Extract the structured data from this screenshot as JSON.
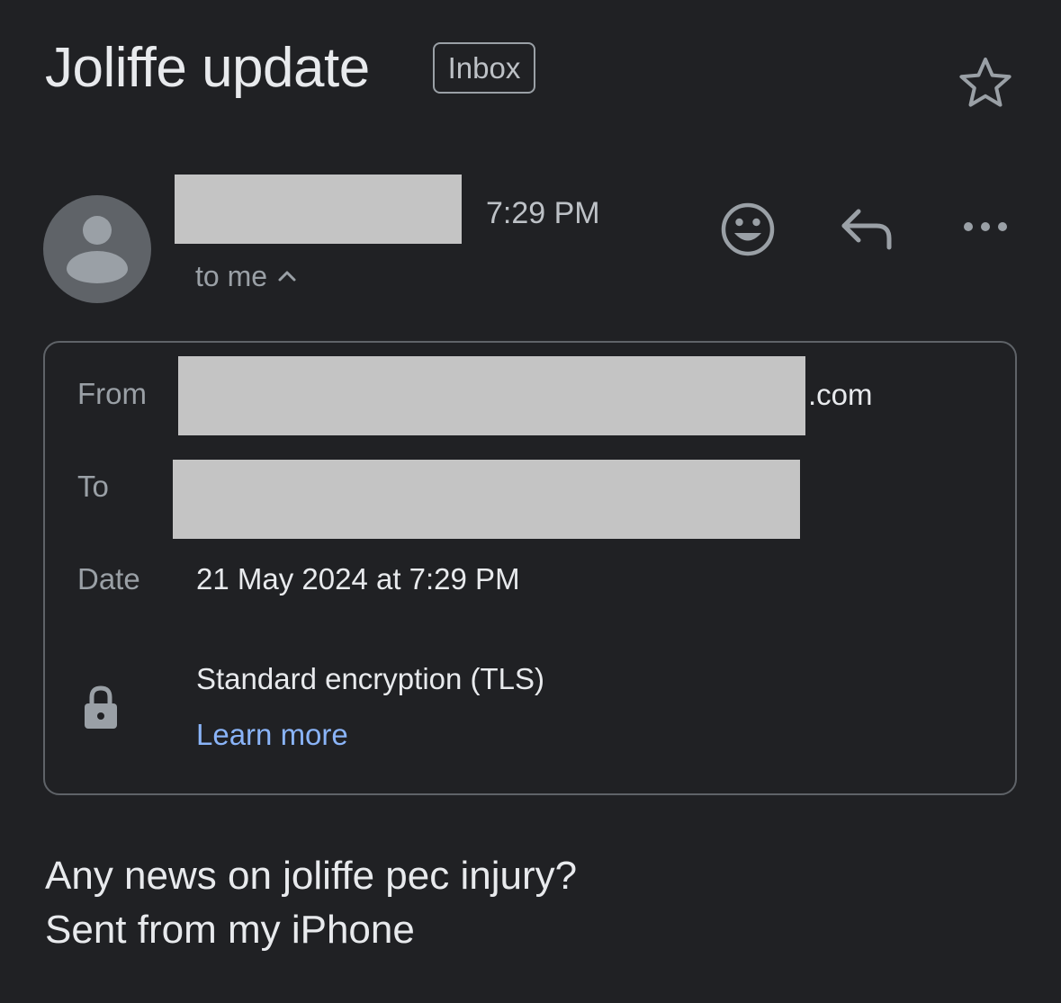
{
  "email": {
    "subject": "Joliffe update",
    "label": "Inbox",
    "time": "7:29 PM",
    "recipient_summary": "to me",
    "details": {
      "from_label": "From",
      "from_suffix": ".com",
      "to_label": "To",
      "date_label": "Date",
      "date_value": "21 May 2024 at 7:29 PM",
      "encryption": "Standard encryption (TLS)",
      "learn_more": "Learn more"
    },
    "body": {
      "line1": "Any news on joliffe pec injury?",
      "line2": "Sent from my iPhone"
    }
  },
  "icons": {
    "star": "star-icon",
    "avatar": "avatar-icon",
    "chevron": "chevron-up-icon",
    "emoji": "emoji-reaction-icon",
    "reply": "reply-icon",
    "more": "more-options-icon",
    "lock": "lock-icon"
  },
  "colors": {
    "background": "#202124",
    "text": "#e8eaed",
    "muted": "#9aa0a6",
    "link": "#8ab4f8",
    "redaction": "#c4c4c4"
  }
}
